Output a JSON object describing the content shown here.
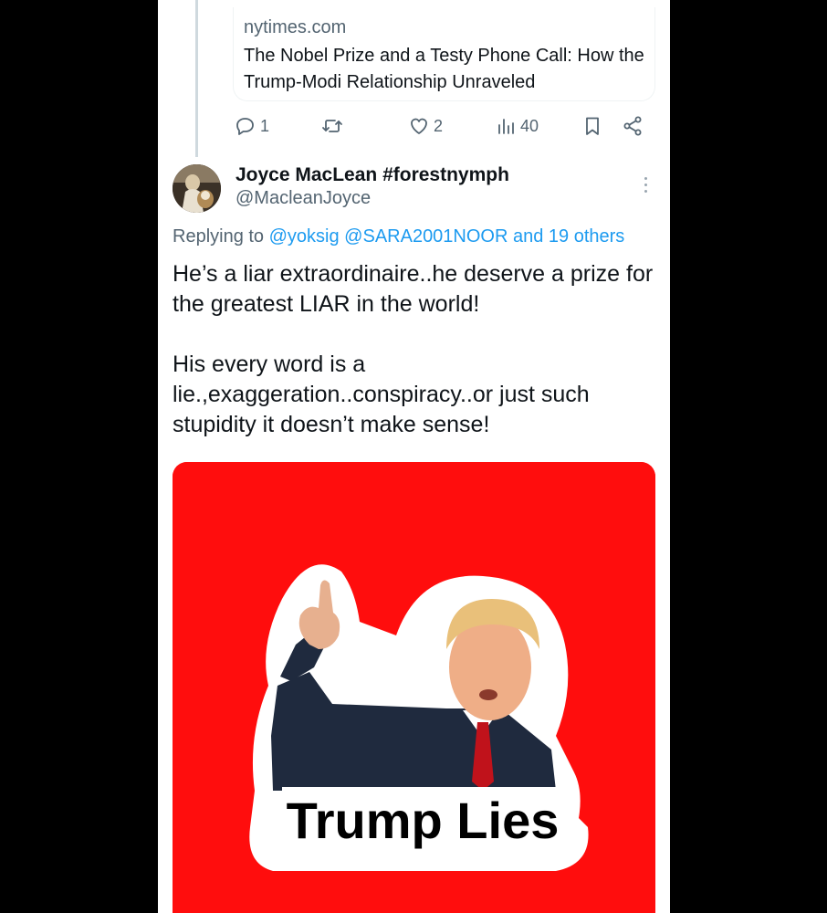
{
  "link_card": {
    "domain": "nytimes.com",
    "title": "The Nobel Prize and a Testy Phone Call: How the Trump-Modi Relationship Unraveled"
  },
  "actions": {
    "reply_count": "1",
    "retweet_count": "",
    "like_count": "2",
    "view_count": "40"
  },
  "reply": {
    "display_name": "Joyce MacLean #forestnymph",
    "handle": "@MacleanJoyce",
    "replying_prefix": "Replying to",
    "replying_to": "@yoksig @SARA2001NOOR and 19 others",
    "text_paragraph_1": "He’s a liar extraordinaire..he deserve a prize for the greatest LIAR in the world!",
    "text_paragraph_2": "His every word is a lie.,exaggeration..conspiracy..or just such stupidity it doesn’t make sense!"
  },
  "media": {
    "caption": "Trump Lies",
    "background_color": "#ff0d0d"
  },
  "colors": {
    "accent": "#1d9bf0",
    "secondary_text": "#536471"
  }
}
